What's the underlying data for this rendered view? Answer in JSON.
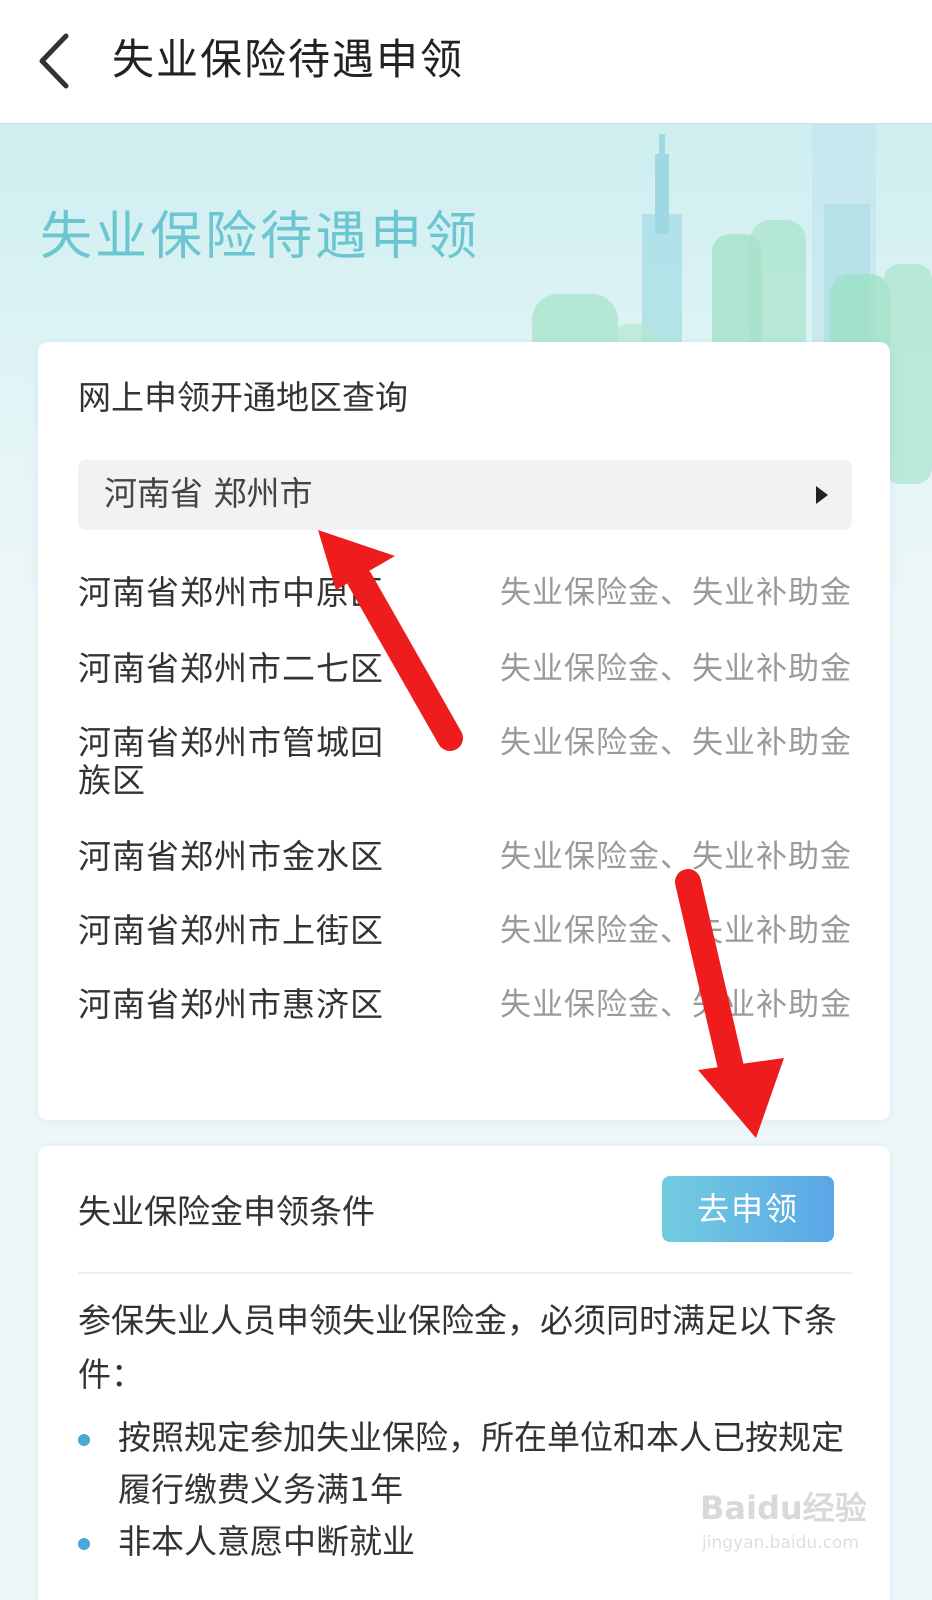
{
  "header": {
    "title": "失业保险待遇申领"
  },
  "hero": {
    "title": "失业保险待遇申领"
  },
  "region_query": {
    "title": "网上申领开通地区查询",
    "selected_region": "河南省 郑州市",
    "rows": [
      {
        "name": "河南省郑州市中原区",
        "benefit": "失业保险金、失业补助金"
      },
      {
        "name": "河南省郑州市二七区",
        "benefit": "失业保险金、失业补助金"
      },
      {
        "name": "河南省郑州市管城回族区",
        "benefit": "失业保险金、失业补助金"
      },
      {
        "name": "河南省郑州市金水区",
        "benefit": "失业保险金、失业补助金"
      },
      {
        "name": "河南省郑州市上街区",
        "benefit": "失业保险金、失业补助金"
      },
      {
        "name": "河南省郑州市惠济区",
        "benefit": "失业保险金、失业补助金"
      }
    ]
  },
  "conditions": {
    "title": "失业保险金申领条件",
    "apply_label": "去申领",
    "intro": "参保失业人员申领失业保险金，必须同时满足以下条件：",
    "items": [
      "按照规定参加失业保险，所在单位和本人已按规定履行缴费义务满1年",
      "非本人意愿中断就业"
    ]
  },
  "watermark": {
    "main": "Baidu经验",
    "sub": "jingyan.baidu.com"
  },
  "colors": {
    "accent": "#6cc6d2",
    "button_start": "#72cce0",
    "button_end": "#5aa6e6",
    "annotation_arrow": "#ee1c1c"
  }
}
